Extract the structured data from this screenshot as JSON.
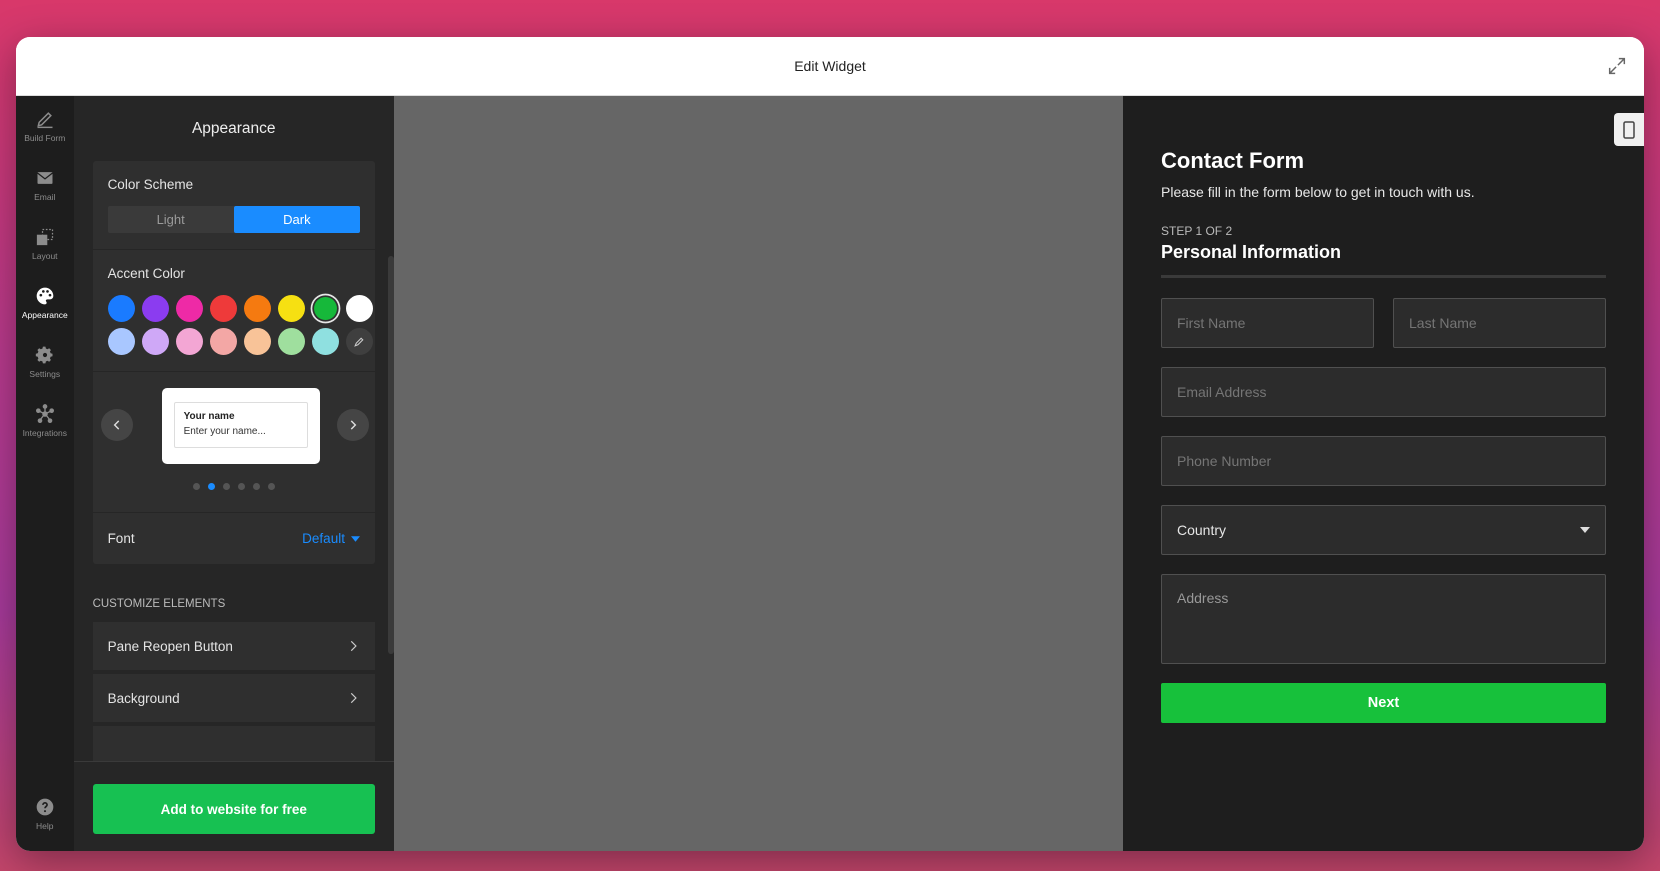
{
  "window": {
    "title": "Edit Widget"
  },
  "rail": {
    "items": [
      {
        "label": "Build Form",
        "icon": "pencil-icon"
      },
      {
        "label": "Email",
        "icon": "mail-icon"
      },
      {
        "label": "Layout",
        "icon": "layout-icon"
      },
      {
        "label": "Appearance",
        "icon": "palette-icon",
        "active": true
      },
      {
        "label": "Settings",
        "icon": "gear-icon"
      },
      {
        "label": "Integrations",
        "icon": "network-icon"
      }
    ],
    "help_label": "Help"
  },
  "panel": {
    "title": "Appearance",
    "color_scheme": {
      "title": "Color Scheme",
      "options": [
        "Light",
        "Dark"
      ],
      "selected": "Dark"
    },
    "accent_color": {
      "title": "Accent Color",
      "colors": [
        "#1a7bff",
        "#8b3cf0",
        "#ee2aa6",
        "#ee3a3a",
        "#f57a10",
        "#f6e012",
        "#16b83a",
        "#ffffff",
        "#a9c7ff",
        "#cfa8f7",
        "#f3a6d4",
        "#f3a7a5",
        "#f8c398",
        "#9fdf9e",
        "#8fe0e0"
      ],
      "selected": "#16b83a"
    },
    "preview_card": {
      "label": "Your name",
      "placeholder": "Enter your name..."
    },
    "dots": {
      "count": 6,
      "active": 1
    },
    "font": {
      "label": "Font",
      "value": "Default"
    },
    "customize_title": "CUSTOMIZE ELEMENTS",
    "customize_items": [
      "Pane Reopen Button",
      "Background"
    ],
    "add_button": "Add to website for free"
  },
  "form": {
    "title": "Contact Form",
    "subtitle": "Please fill in the form below to get in touch with us.",
    "step": "STEP 1 OF 2",
    "section": "Personal Information",
    "first_name": "First Name",
    "last_name": "Last Name",
    "email": "Email Address",
    "phone": "Phone Number",
    "country": "Country",
    "address": "Address",
    "next": "Next"
  }
}
